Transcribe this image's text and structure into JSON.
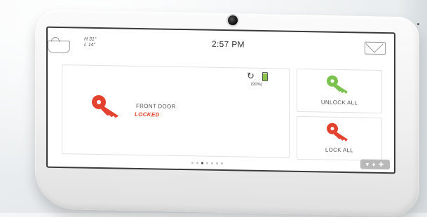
{
  "header": {
    "time": "2:57 PM",
    "weather": {
      "high": "H 31°",
      "low": "L 14°",
      "icon": "weather-icon"
    },
    "messages_icon": "envelope-icon"
  },
  "device": {
    "camera_icon": "camera-lens",
    "status": {
      "refresh_icon": "refresh-icon",
      "battery_icon": "battery-icon",
      "battery_level": "(90%)"
    }
  },
  "main_tile": {
    "name": "FRONT DOOR",
    "status": "LOCKED",
    "icon": "key-icon",
    "color": "#e3432e"
  },
  "actions": [
    {
      "label": "UNLOCK ALL",
      "icon": "key-icon",
      "color": "#7cc24f"
    },
    {
      "label": "LOCK ALL",
      "icon": "key-icon",
      "color": "#e3432e"
    }
  ],
  "pagination": {
    "count": 7,
    "active_index": 2
  },
  "footer": {
    "emergency_icons": "▾ ♦ ✚"
  }
}
